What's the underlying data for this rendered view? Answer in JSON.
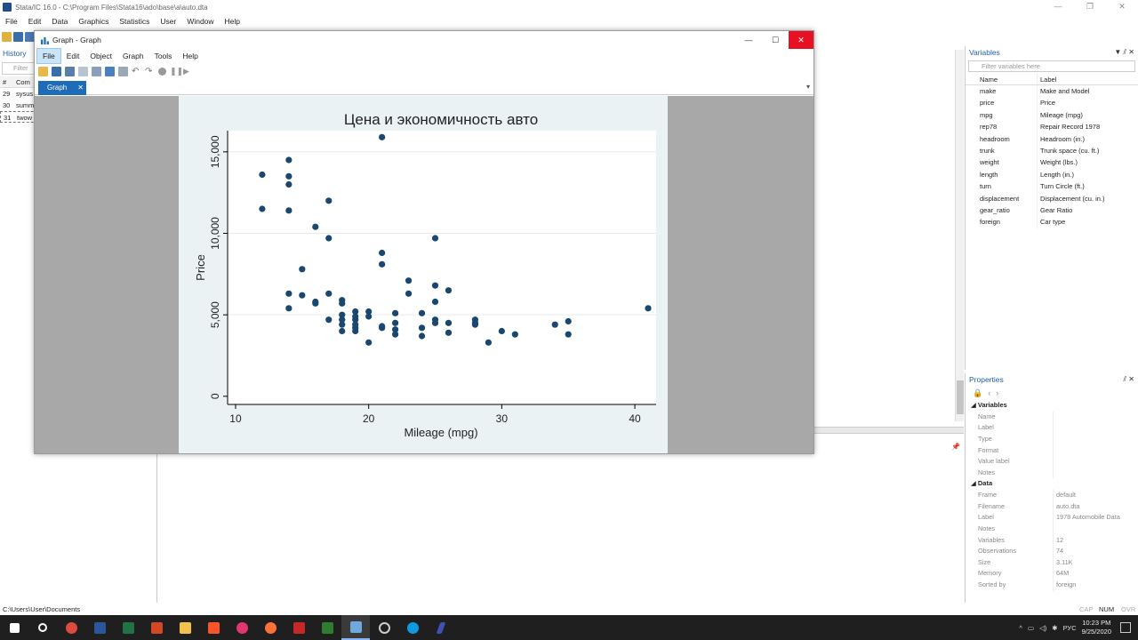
{
  "main_window": {
    "title": "Stata/IC 16.0 - C:\\Program Files\\Stata16\\ado\\base\\a\\auto.dta",
    "menu": [
      "File",
      "Edit",
      "Data",
      "Graphics",
      "Statistics",
      "User",
      "Window",
      "Help"
    ]
  },
  "history": {
    "title": "History",
    "filter_placeholder": "Filter",
    "col_num": "#",
    "col_cmd": "Com",
    "rows": [
      {
        "num": "29",
        "cmd": "sysus"
      },
      {
        "num": "30",
        "cmd": "summ"
      },
      {
        "num": "31",
        "cmd": "twow"
      }
    ]
  },
  "graph_window": {
    "title": "Graph - Graph",
    "menu": [
      "File",
      "Edit",
      "Object",
      "Graph",
      "Tools",
      "Help"
    ],
    "active_menu_index": 0,
    "tab_label": "Graph",
    "tab_close": "✕"
  },
  "variables": {
    "title": "Variables",
    "filter_placeholder": "Filter variables here",
    "col_name": "Name",
    "col_label": "Label",
    "rows": [
      {
        "name": "make",
        "label": "Make and Model"
      },
      {
        "name": "price",
        "label": "Price"
      },
      {
        "name": "mpg",
        "label": "Mileage (mpg)"
      },
      {
        "name": "rep78",
        "label": "Repair Record 1978"
      },
      {
        "name": "headroom",
        "label": "Headroom (in.)"
      },
      {
        "name": "trunk",
        "label": "Trunk space (cu. ft.)"
      },
      {
        "name": "weight",
        "label": "Weight (lbs.)"
      },
      {
        "name": "length",
        "label": "Length (in.)"
      },
      {
        "name": "turn",
        "label": "Turn Circle (ft.)"
      },
      {
        "name": "displacement",
        "label": "Displacement (cu. in.)"
      },
      {
        "name": "gear_ratio",
        "label": "Gear Ratio"
      },
      {
        "name": "foreign",
        "label": "Car type"
      }
    ]
  },
  "properties": {
    "title": "Properties",
    "variables_section": "Variables",
    "variable_rows": [
      {
        "key": "Name",
        "value": ""
      },
      {
        "key": "Label",
        "value": ""
      },
      {
        "key": "Type",
        "value": ""
      },
      {
        "key": "Format",
        "value": ""
      },
      {
        "key": "Value label",
        "value": ""
      },
      {
        "key": "Notes",
        "value": ""
      }
    ],
    "data_section": "Data",
    "data_rows": [
      {
        "key": "Frame",
        "value": "default"
      },
      {
        "key": "Filename",
        "value": "auto.dta"
      },
      {
        "key": "Label",
        "value": "1978 Automobile Data"
      },
      {
        "key": "Notes",
        "value": ""
      },
      {
        "key": "Variables",
        "value": "12"
      },
      {
        "key": "Observations",
        "value": "74"
      },
      {
        "key": "Size",
        "value": "3.11K"
      },
      {
        "key": "Memory",
        "value": "64M"
      },
      {
        "key": "Sorted by",
        "value": "foreign"
      }
    ]
  },
  "statusbar": {
    "path": "C:\\Users\\User\\Documents",
    "cap": "CAP",
    "num": "NUM",
    "ovr": "OVR"
  },
  "taskbar": {
    "lang": "РУС",
    "time": "10:23 PM",
    "date": "9/25/2020"
  },
  "colors": {
    "accent": "#1e6bb8",
    "marker": "#1a476f",
    "plot_region": "#ffffff",
    "graph_bg": "#eaf2f3"
  },
  "chart_data": {
    "type": "scatter",
    "title": "Цена и экономичность авто",
    "xlabel": "Mileage (mpg)",
    "ylabel": "Price",
    "xlim": [
      9.4,
      41.6
    ],
    "ylim": [
      -500,
      16300
    ],
    "xticks": [
      10,
      20,
      30,
      40
    ],
    "xtick_labels": [
      "10",
      "20",
      "30",
      "40"
    ],
    "yticks": [
      0,
      5000,
      10000,
      15000
    ],
    "ytick_labels": [
      "0",
      "5,000",
      "10,000",
      "15,000"
    ],
    "grid": true,
    "legend": "none",
    "points": [
      [
        12,
        13600
      ],
      [
        12,
        11500
      ],
      [
        14,
        14500
      ],
      [
        14,
        13500
      ],
      [
        14,
        13000
      ],
      [
        14,
        11400
      ],
      [
        14,
        6300
      ],
      [
        14,
        5400
      ],
      [
        15,
        7800
      ],
      [
        15,
        6200
      ],
      [
        16,
        10400
      ],
      [
        16,
        5800
      ],
      [
        16,
        5700
      ],
      [
        17,
        12000
      ],
      [
        17,
        9700
      ],
      [
        17,
        6300
      ],
      [
        17,
        4700
      ],
      [
        18,
        5900
      ],
      [
        18,
        5700
      ],
      [
        18,
        5000
      ],
      [
        18,
        4700
      ],
      [
        18,
        4400
      ],
      [
        18,
        4000
      ],
      [
        19,
        5200
      ],
      [
        19,
        4900
      ],
      [
        19,
        4700
      ],
      [
        19,
        4400
      ],
      [
        19,
        4200
      ],
      [
        19,
        4000
      ],
      [
        20,
        5200
      ],
      [
        20,
        4900
      ],
      [
        20,
        3300
      ],
      [
        21,
        15900
      ],
      [
        21,
        8800
      ],
      [
        21,
        8100
      ],
      [
        21,
        4300
      ],
      [
        21,
        4200
      ],
      [
        22,
        5100
      ],
      [
        22,
        4500
      ],
      [
        22,
        4100
      ],
      [
        22,
        3800
      ],
      [
        23,
        7100
      ],
      [
        23,
        6300
      ],
      [
        24,
        5100
      ],
      [
        24,
        4200
      ],
      [
        24,
        3700
      ],
      [
        25,
        9700
      ],
      [
        25,
        6800
      ],
      [
        25,
        5800
      ],
      [
        25,
        4700
      ],
      [
        25,
        4500
      ],
      [
        26,
        6500
      ],
      [
        26,
        4500
      ],
      [
        26,
        3900
      ],
      [
        28,
        4700
      ],
      [
        28,
        4500
      ],
      [
        28,
        4400
      ],
      [
        29,
        3300
      ],
      [
        30,
        4000
      ],
      [
        31,
        3800
      ],
      [
        34,
        4400
      ],
      [
        35,
        4600
      ],
      [
        35,
        3800
      ],
      [
        41,
        5400
      ]
    ]
  }
}
